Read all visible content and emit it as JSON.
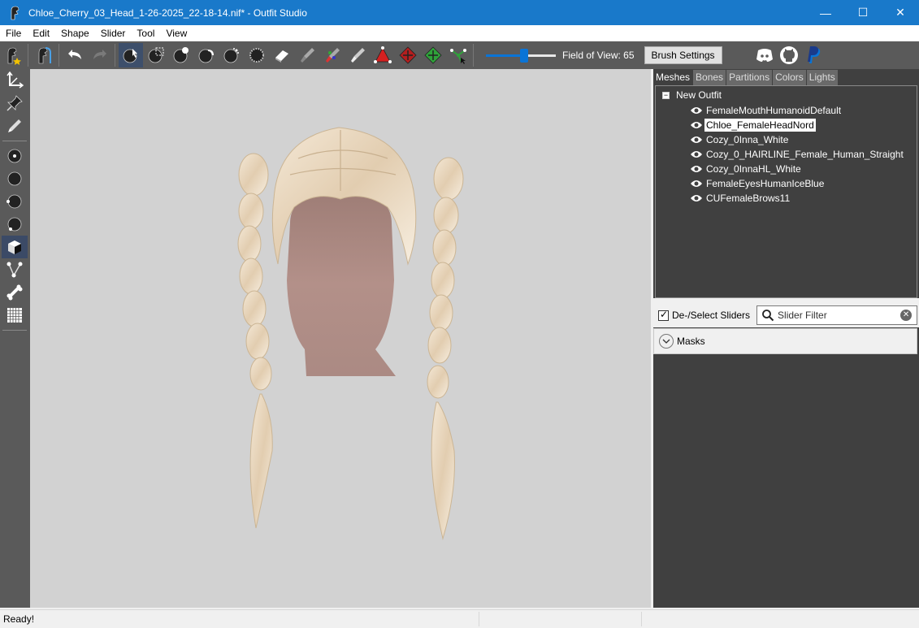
{
  "window": {
    "title": "Chloe_Cherry_03_Head_1-26-2025_22-18-14.nif* - Outfit Studio",
    "minimize": "—",
    "maximize": "☐",
    "close": "✕"
  },
  "menu": [
    "File",
    "Edit",
    "Shape",
    "Slider",
    "Tool",
    "View"
  ],
  "toolbar": {
    "fov_label": "Field of View: 65",
    "fov_value": 65,
    "brush_settings": "Brush Settings",
    "icons": [
      "new-project-icon",
      "load-reference-icon",
      "undo-icon",
      "redo-icon",
      "select-icon",
      "mask-rect-icon",
      "mask-brush-icon",
      "unmask-icon",
      "inflate-icon",
      "deflate-icon",
      "smooth-icon",
      "move-icon",
      "weight-paint-icon",
      "color-paint-icon",
      "alpha-paint-icon",
      "transform-icon",
      "pivot-icon",
      "collapse-vertex-icon"
    ]
  },
  "left_tools": [
    "pivot-axis-icon",
    "pin-icon",
    "pencil-icon",
    "brush-small-icon",
    "brush-medium-icon",
    "brush-large-icon",
    "brush-xl-icon",
    "cube-icon",
    "vertex-edit-icon",
    "bone-icon",
    "grid-icon"
  ],
  "panel": {
    "tabs": [
      "Meshes",
      "Bones",
      "Partitions",
      "Colors",
      "Lights"
    ],
    "active_tab": "Meshes",
    "root": "New Outfit",
    "meshes": [
      {
        "name": "FemaleMouthHumanoidDefault",
        "selected": false
      },
      {
        "name": "Chloe_FemaleHeadNord",
        "selected": true
      },
      {
        "name": "Cozy_0Inna_White",
        "selected": false
      },
      {
        "name": "Cozy_0_HAIRLINE_Female_Human_Straight",
        "selected": false
      },
      {
        "name": "Cozy_0InnaHL_White",
        "selected": false
      },
      {
        "name": "FemaleEyesHumanIceBlue",
        "selected": false
      },
      {
        "name": "CUFemaleBrows11",
        "selected": false
      }
    ],
    "deselect_label": "De-/Select Sliders",
    "filter_placeholder": "Slider Filter",
    "masks_label": "Masks"
  },
  "status": {
    "text": "Ready!"
  },
  "colors": {
    "titlebar": "#1979ca",
    "toolbar": "#5a5a5a",
    "viewport": "#d2d2d2",
    "panel": "#404040",
    "accent": "#0a74d6"
  }
}
